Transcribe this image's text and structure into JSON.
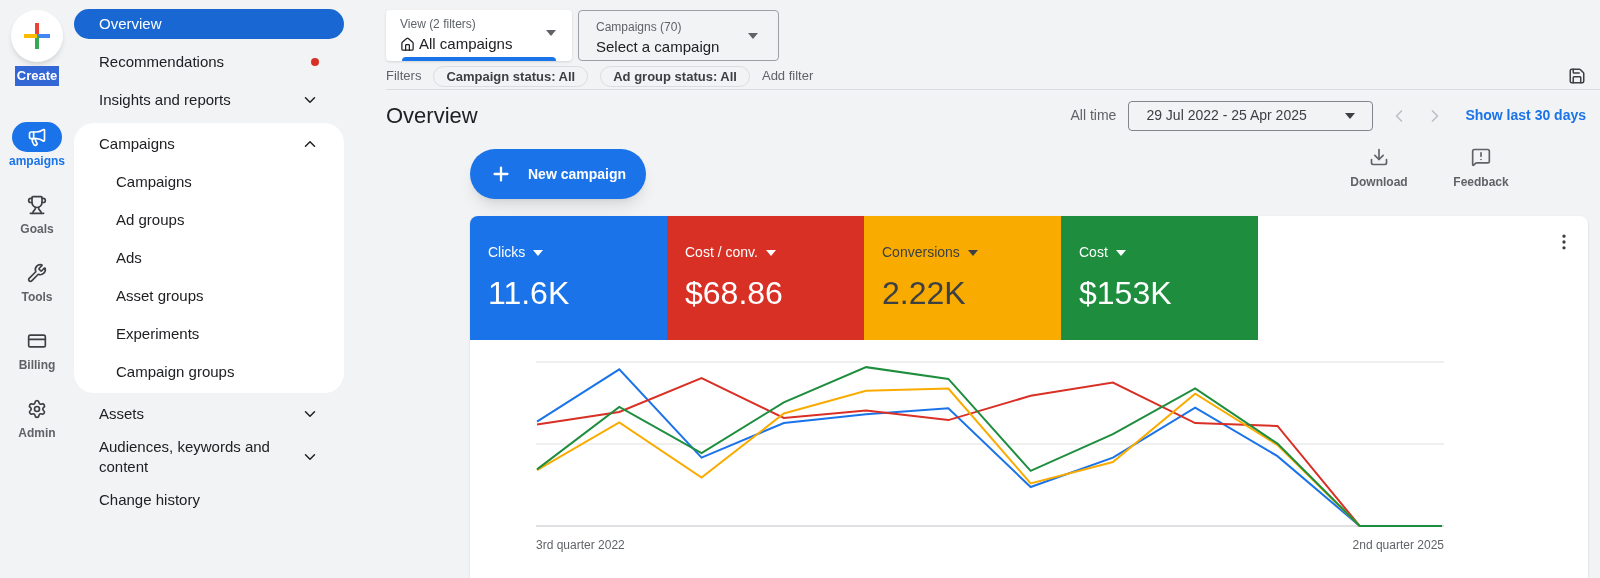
{
  "rail": {
    "create": "Create",
    "items": [
      {
        "kind": "campaigns",
        "label": "ampaigns",
        "selected": true
      },
      {
        "kind": "goals",
        "label": "Goals",
        "selected": false
      },
      {
        "kind": "tools",
        "label": "Tools",
        "selected": false
      },
      {
        "kind": "billing",
        "label": "Billing",
        "selected": false
      },
      {
        "kind": "admin",
        "label": "Admin",
        "selected": false
      }
    ]
  },
  "nav": [
    {
      "kind": "link",
      "label": "Overview",
      "selected": true,
      "alert": false
    },
    {
      "kind": "link",
      "label": "Recommendations",
      "selected": false,
      "alert": true
    },
    {
      "kind": "group",
      "label": "Insights and reports",
      "expanded": false
    },
    {
      "kind": "group",
      "label": "Campaigns",
      "expanded": true,
      "children": [
        {
          "label": "Campaigns",
          "selected": false
        },
        {
          "label": "Ad groups",
          "selected": false
        },
        {
          "label": "Ads",
          "selected": false
        },
        {
          "label": "Asset groups",
          "selected": false
        },
        {
          "label": "Experiments",
          "selected": false
        },
        {
          "label": "Campaign groups",
          "selected": false
        }
      ]
    },
    {
      "kind": "group",
      "label": "Assets",
      "expanded": false
    },
    {
      "kind": "group",
      "label": "Audiences, keywords and content",
      "expanded": false
    },
    {
      "kind": "link",
      "label": "Change history",
      "selected": false,
      "alert": false
    }
  ],
  "view_selector": {
    "label": "View (2 filters)",
    "value": "All campaigns"
  },
  "campaign_selector": {
    "label": "Campaigns (70)",
    "value": "Select a campaign"
  },
  "filters": {
    "label": "Filters",
    "chips": [
      "Campaign status: All",
      "Ad group status: All"
    ],
    "add": "Add filter"
  },
  "title": "Overview",
  "date": {
    "label": "All time",
    "range": "29 Jul 2022 - 25 Apr 2025",
    "action": "Show last 30 days"
  },
  "new_campaign": "New campaign",
  "tools": [
    {
      "kind": "download",
      "label": "Download"
    },
    {
      "kind": "feedback",
      "label": "Feedback"
    }
  ],
  "metrics": [
    {
      "label": "Clicks",
      "value": "11.6K",
      "color": "#1a73e8",
      "dark_text": false
    },
    {
      "label": "Cost / conv.",
      "value": "$68.86",
      "color": "#d93025",
      "dark_text": false
    },
    {
      "label": "Conversions",
      "value": "2.22K",
      "color": "#f9ab00",
      "dark_text": true
    },
    {
      "label": "Cost",
      "value": "$153K",
      "color": "#1e8e3e",
      "dark_text": false
    }
  ],
  "chart": {
    "x_start": "3rd quarter 2022",
    "x_end": "2nd quarter 2025"
  }
}
